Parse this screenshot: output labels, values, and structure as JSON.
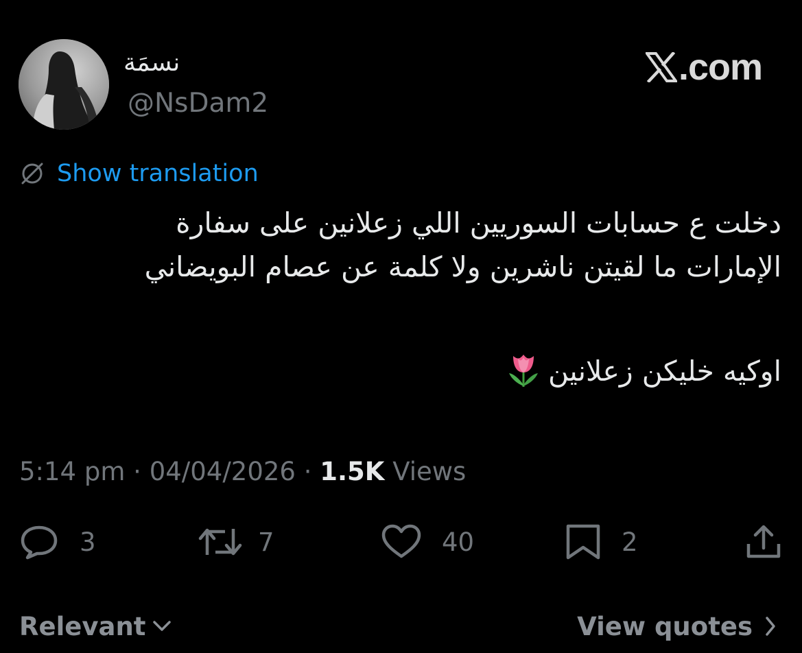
{
  "header": {
    "display_name": "نسمَة",
    "handle": "@NsDam2",
    "site": ".com"
  },
  "translation": {
    "label": "Show translation"
  },
  "tweet": {
    "line1": "دخلت ع حسابات السوريين اللي زعلانين على سفارة",
    "line2": "الإمارات ما لقيتن ناشرين ولا كلمة عن عصام البويضاني",
    "line3": "اوكيه خليكن زعلانين",
    "emoji": "tulip"
  },
  "meta": {
    "time": "5:14 pm",
    "separator": " · ",
    "date": "04/04/2026",
    "views_count": "1.5K",
    "views_label": " Views"
  },
  "actions": {
    "replies": "3",
    "reposts": "7",
    "likes": "40",
    "bookmarks": "2"
  },
  "footer": {
    "sort_label": "Relevant",
    "quotes_label": "View quotes"
  },
  "colors": {
    "background": "#000000",
    "text": "#e7e9ea",
    "muted": "#71767b",
    "link": "#1d9bf0"
  }
}
